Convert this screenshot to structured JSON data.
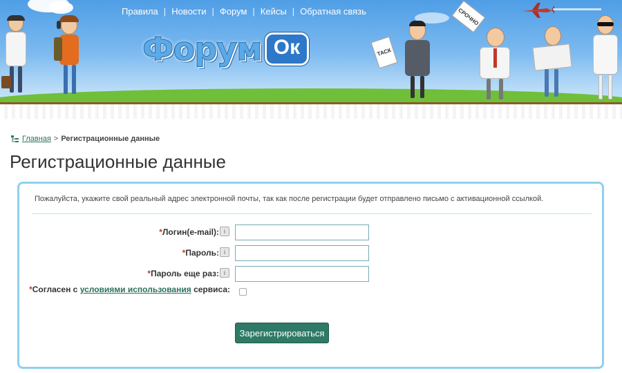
{
  "header": {
    "nav": [
      {
        "label": "Правила"
      },
      {
        "label": "Новости"
      },
      {
        "label": "Форум"
      },
      {
        "label": "Кейсы"
      },
      {
        "label": "Обратная связь"
      }
    ],
    "separator": "|",
    "logo": {
      "main": "Форум",
      "badge": "Ок"
    },
    "signs": {
      "urgent": "СРОЧНО",
      "task": "ТАСК"
    }
  },
  "breadcrumb": {
    "home": "Главная",
    "separator": ">",
    "current": "Регистрационные данные"
  },
  "page_title": "Регистрационные данные",
  "form": {
    "notice": "Пожалуйста, укажите свой реальный адрес электронной почты, так как после регистрации будет отправлено письмо с активационной ссылкой.",
    "required_mark": "*",
    "login_label": "Логин(e-mail):",
    "login_value": "",
    "password_label": "Пароль:",
    "password_value": "",
    "password2_label": "Пароль еще раз:",
    "password2_value": "",
    "help_glyph": "i",
    "agree_prefix": "Согласен с ",
    "agree_link": "условиями использования",
    "agree_suffix": " сервиса:",
    "agree_checked": false,
    "submit_label": "Зарегистрироваться"
  },
  "colors": {
    "accent": "#2f7a67",
    "box_border": "#8fd0ee",
    "required": "#c0392b",
    "link": "#2c6e5d"
  }
}
